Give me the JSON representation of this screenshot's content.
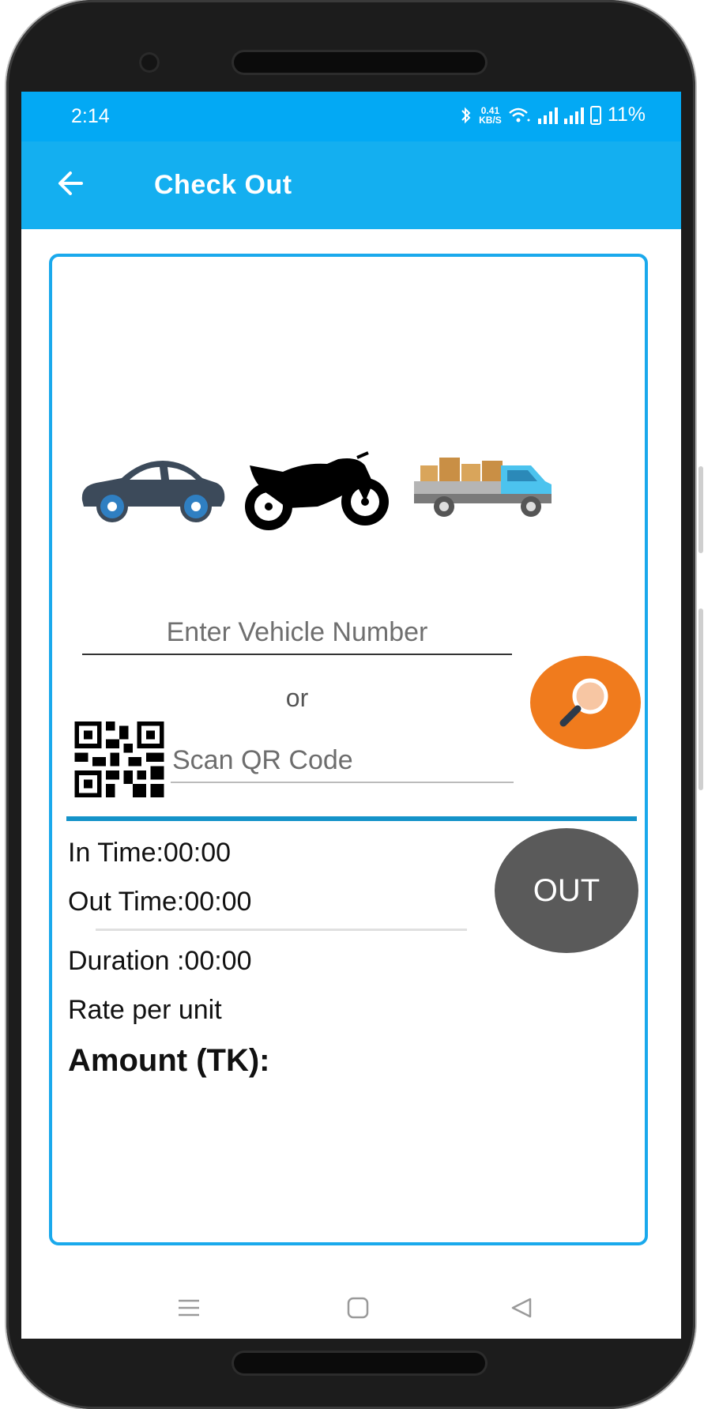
{
  "status_bar": {
    "time": "2:14",
    "speed_value": "0.41",
    "speed_unit": "KB/S",
    "battery": "11%"
  },
  "app_bar": {
    "title": "Check Out"
  },
  "form": {
    "vehicle_placeholder": "Enter Vehicle Number",
    "or_text": "or",
    "qr_placeholder": "Scan QR Code"
  },
  "info": {
    "in_time": "In Time:00:00",
    "out_time": "Out Time:00:00",
    "duration": "Duration :00:00",
    "rate": "Rate per unit",
    "amount": "Amount (TK):"
  },
  "buttons": {
    "out": "OUT"
  },
  "colors": {
    "status_bar": "#03a9f4",
    "app_bar": "#14aff0",
    "card_border": "#1aa9ec",
    "search_button": "#f07b1d",
    "out_button": "#5a5a5a"
  }
}
